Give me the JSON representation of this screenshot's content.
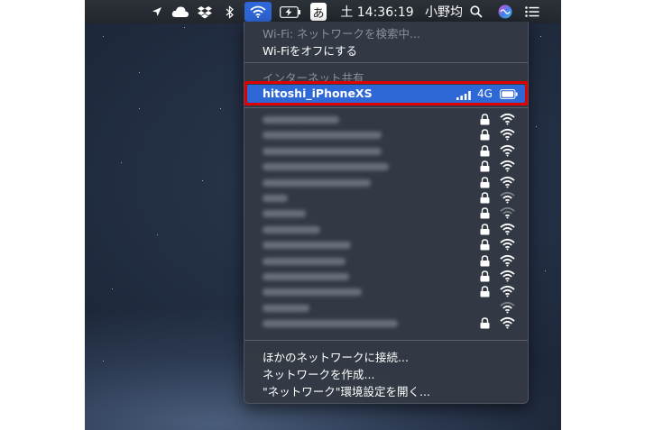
{
  "menubar": {
    "clock": "土 14:36:19",
    "user": "小野均",
    "ime_char": "あ",
    "icons": [
      "location-arrow-icon",
      "cloud-icon",
      "dropbox-icon",
      "bluetooth-icon",
      "wifi-icon",
      "battery-icon",
      "ime-icon",
      "search-icon",
      "siri-icon",
      "control-list-icon"
    ]
  },
  "wifi_menu": {
    "status": "Wi-Fi: ネットワークを検索中...",
    "turn_off": "Wi-Fiをオフにする",
    "hotspot_header": "インターネット共有",
    "hotspot": {
      "name": "hitoshi_iPhoneXS",
      "network_type": "4G",
      "signal_bars": 4,
      "battery_icon": "battery-icon"
    },
    "networks": [
      {
        "locked": true,
        "signal": 3
      },
      {
        "locked": true,
        "signal": 3
      },
      {
        "locked": true,
        "signal": 3
      },
      {
        "locked": true,
        "signal": 3
      },
      {
        "locked": true,
        "signal": 3
      },
      {
        "locked": true,
        "signal": 2
      },
      {
        "locked": true,
        "signal": 1
      },
      {
        "locked": true,
        "signal": 3
      },
      {
        "locked": true,
        "signal": 3
      },
      {
        "locked": true,
        "signal": 3
      },
      {
        "locked": true,
        "signal": 3
      },
      {
        "locked": true,
        "signal": 3
      },
      {
        "locked": false,
        "signal": 2
      },
      {
        "locked": true,
        "signal": 3
      }
    ],
    "footer": {
      "join_other": "ほかのネットワークに接続...",
      "create": "ネットワークを作成...",
      "open_prefs": "\"ネットワーク\"環境設定を開く..."
    },
    "colors": {
      "highlight": "#2e67d6",
      "annotation_frame": "#e10000",
      "menu_bg": "#343a44"
    }
  }
}
